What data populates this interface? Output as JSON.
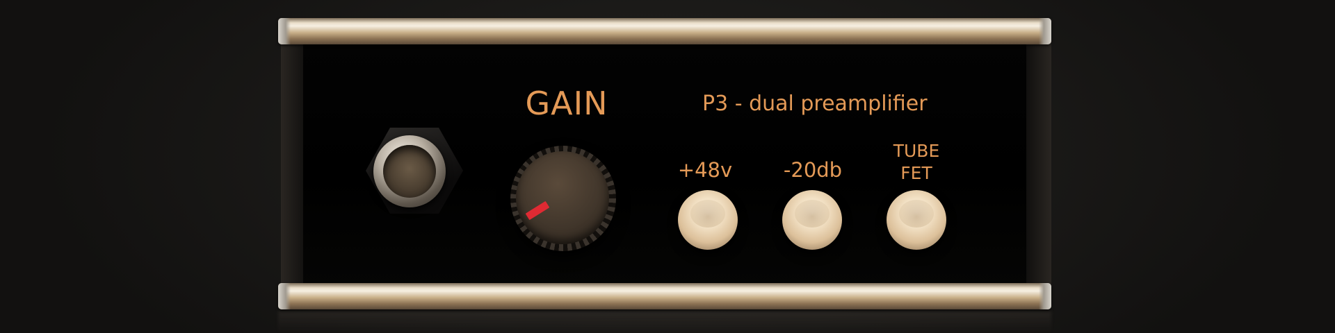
{
  "panel": {
    "gain_label": "GAIN",
    "model_label": "P3 - dual preamplifier"
  },
  "buttons": {
    "phantom_label": "+48v",
    "pad_label": "-20db",
    "mode_top_label": "TUBE",
    "mode_bottom_label": "FET"
  },
  "colors": {
    "label_text": "#e49a57",
    "knob_pointer": "#e02a33",
    "faceplate": "#000000",
    "button_cap": "#f3e2c6"
  },
  "icons": {
    "input_jack": "xlr-jack-icon",
    "gain_knob": "rotary-knob-icon"
  }
}
